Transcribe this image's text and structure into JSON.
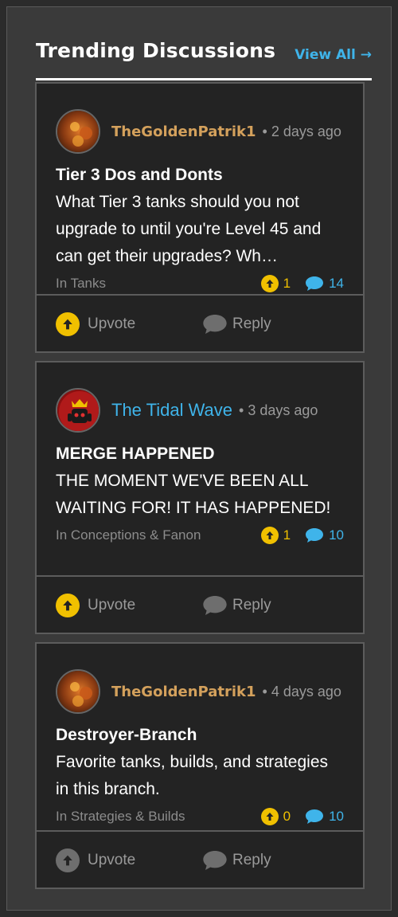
{
  "header": {
    "title": "Trending Discussions",
    "view_all": "View All →"
  },
  "colors": {
    "accent_blue": "#3fb4ea",
    "upvote_yellow": "#f0c000",
    "author_gold": "#d4a15c"
  },
  "discussions": [
    {
      "author": "TheGoldenPatrik1",
      "time": "• 2 days ago",
      "title": "Tier 3 Dos and Donts",
      "excerpt": "What Tier 3 tanks should you not upgrade to until you're Level 45 and can get their upgrades? Wh…",
      "category": "In Tanks",
      "upvotes": "1",
      "replies": "14",
      "upvote_label": "Upvote",
      "reply_label": "Reply",
      "upvoted": true
    },
    {
      "author": "The Tidal Wave",
      "time": "• 3 days ago",
      "title": "MERGE HAPPENED",
      "excerpt": "THE MOMENT WE'VE BEEN ALL WAITING FOR! IT HAS HAPPENED!",
      "category": "In Conceptions & Fanon",
      "upvotes": "1",
      "replies": "10",
      "upvote_label": "Upvote",
      "reply_label": "Reply",
      "upvoted": true
    },
    {
      "author": "TheGoldenPatrik1",
      "time": "• 4 days ago",
      "title": "Destroyer-Branch",
      "excerpt": "Favorite tanks, builds, and strategies in this branch.",
      "category": "In Strategies & Builds",
      "upvotes": "0",
      "replies": "10",
      "upvote_label": "Upvote",
      "reply_label": "Reply",
      "upvoted": false
    }
  ]
}
